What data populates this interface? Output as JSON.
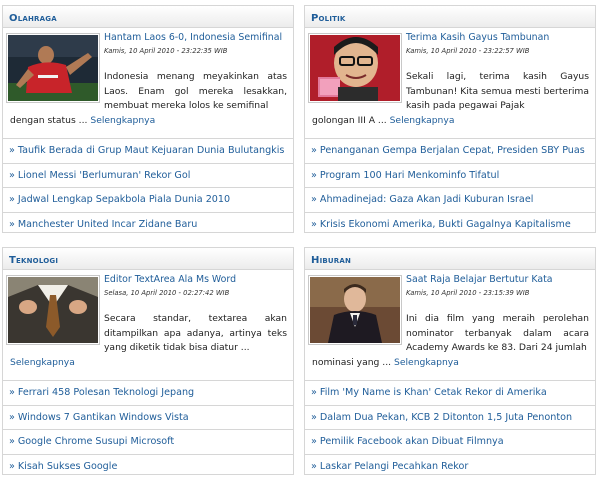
{
  "sections": [
    {
      "heading": "Olahraga",
      "feature": {
        "title": "Hantam Laos 6-0, Indonesia Semifinal",
        "date": "Kamis, 10 April 2010 - 23:22:35 WIB",
        "desc": "Indonesia menang meyakinkan atas Laos. Enam gol mereka lesakkan, membuat mereka lolos ke semifinal",
        "desc_tail": "dengan status ...",
        "more": "Selengkapnya",
        "image_icon": "football-player-photo"
      },
      "links": [
        "Taufik Berada di Grup Maut Kejuaran Dunia Bulutangkis",
        "Lionel Messi 'Berlumuran' Rekor Gol",
        "Jadwal Lengkap Sepakbola Piala Dunia 2010",
        "Manchester United Incar Zidane Baru"
      ]
    },
    {
      "heading": "Politik",
      "feature": {
        "title": "Terima Kasih Gayus Tambunan",
        "date": "Kamis, 10 April 2010 - 23:22:57 WIB",
        "desc": "Sekali lagi, terima kasih Gayus Tambunan! Kita semua mesti berterima kasih pada pegawai Pajak",
        "desc_tail": "golongan III A ...",
        "more": "Selengkapnya",
        "image_icon": "caricature-photo"
      },
      "links": [
        "Penanganan Gempa Berjalan Cepat, Presiden SBY Puas",
        "Program 100 Hari Menkominfo Tifatul",
        "Ahmadinejad: Gaza Akan Jadi Kuburan Israel",
        "Krisis Ekonomi Amerika, Bukti Gagalnya Kapitalisme"
      ]
    },
    {
      "heading": "Teknologi",
      "feature": {
        "title": "Editor TextArea Ala Ms Word",
        "date": "Selasa, 10 April 2010 - 02:27:42 WIB",
        "desc": "Secara standar, textarea akan ditampilkan apa adanya, artinya teks yang diketik tidak bisa diatur ...",
        "desc_tail": "",
        "more": "Selengkapnya",
        "image_icon": "businessman-tie-photo"
      },
      "links": [
        "Ferrari 458 Polesan Teknologi Jepang",
        "Windows 7 Gantikan Windows Vista",
        "Google Chrome Susupi Microsoft",
        "Kisah Sukses Google"
      ]
    },
    {
      "heading": "Hiburan",
      "feature": {
        "title": "Saat Raja Belajar Bertutur Kata",
        "date": "Kamis, 10 April 2010 - 23:15:39 WIB",
        "desc": "Ini dia film yang meraih perolehan nominator terbanyak dalam acara Academy Awards ke 83. Dari 24 jumlah",
        "desc_tail": "nominasi yang ...",
        "more": "Selengkapnya",
        "image_icon": "actor-photo"
      },
      "links": [
        "Film 'My Name is Khan' Cetak Rekor di Amerika",
        "Dalam Dua Pekan, KCB 2 Ditonton 1,5 Juta Penonton",
        "Pemilik Facebook akan Dibuat Filmnya",
        "Laskar Pelangi Pecahkan Rekor"
      ]
    }
  ]
}
